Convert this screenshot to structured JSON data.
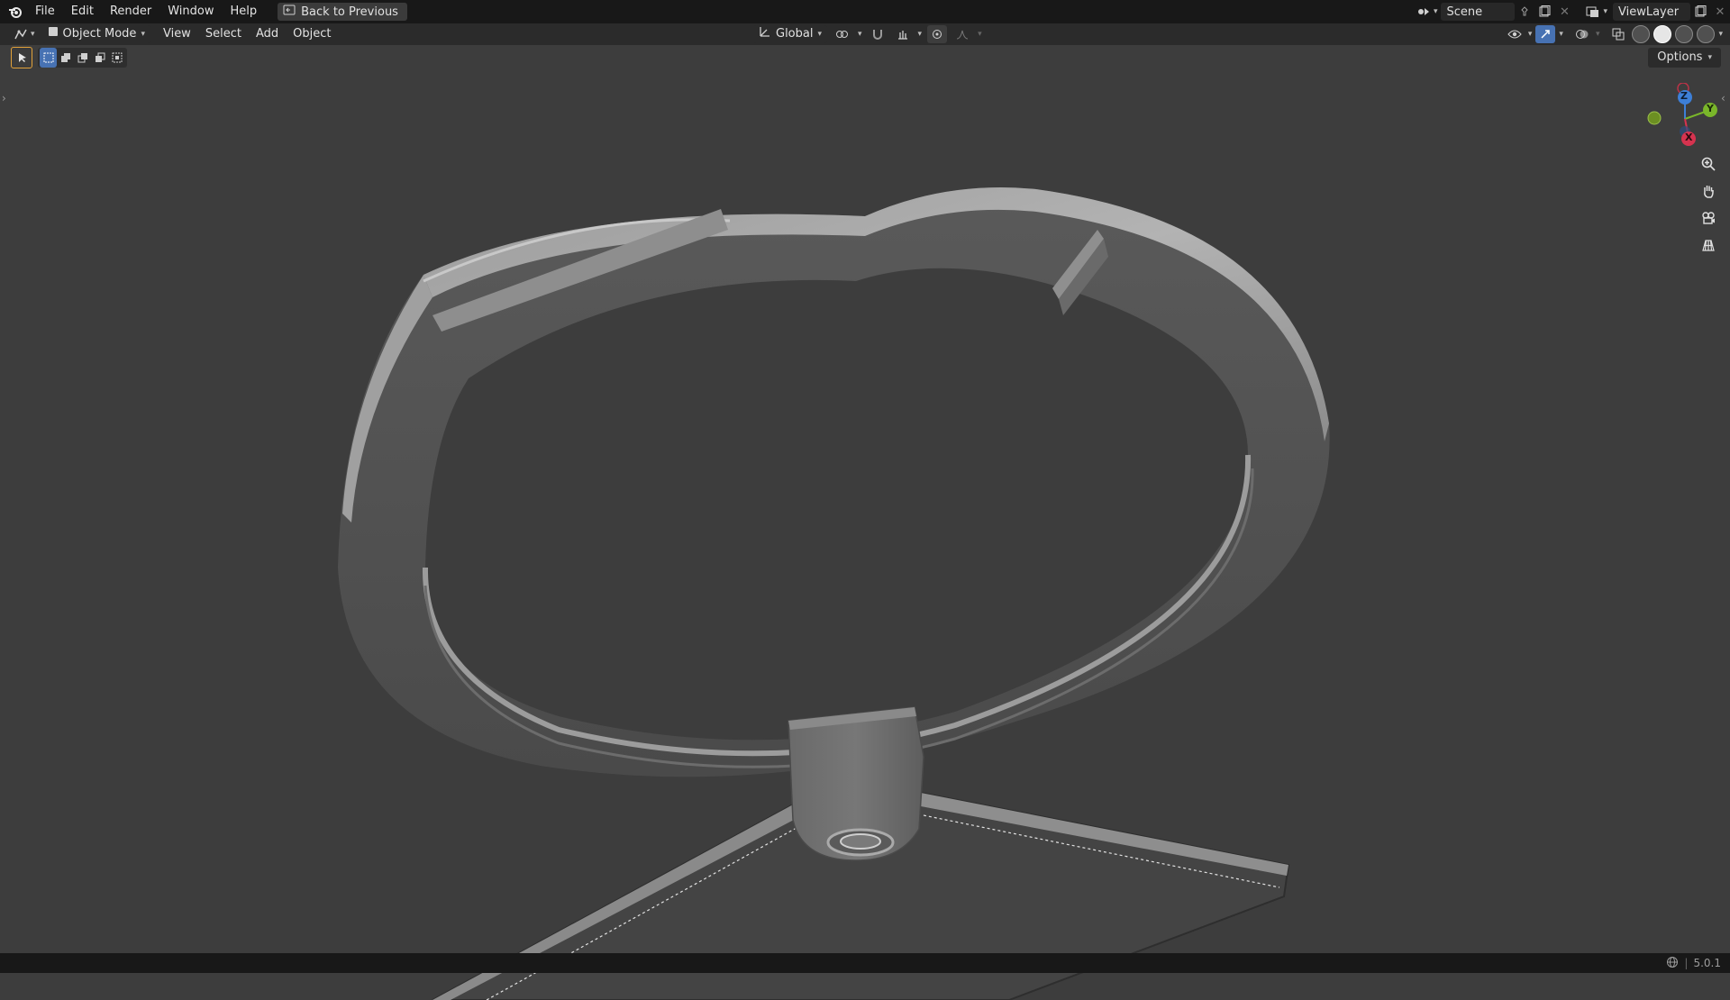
{
  "topbar": {
    "menus": [
      "File",
      "Edit",
      "Render",
      "Window",
      "Help"
    ],
    "back_label": "Back to Previous",
    "scene_name": "Scene",
    "view_layer": "ViewLayer"
  },
  "header": {
    "mode": "Object Mode",
    "menus": [
      "View",
      "Select",
      "Add",
      "Object"
    ],
    "transform_orientation": "Global",
    "options_label": "Options"
  },
  "gizmo": {
    "z": "Z",
    "y": "Y",
    "x": "X"
  },
  "status": {
    "version": "5.0.1"
  },
  "icons": {
    "logo": "blender-logo-icon",
    "back": "back-icon",
    "editor": "editor-type-icon",
    "zoom": "zoom-icon",
    "pan": "hand-icon",
    "camera": "camera-icon",
    "grid": "grid-icon"
  }
}
